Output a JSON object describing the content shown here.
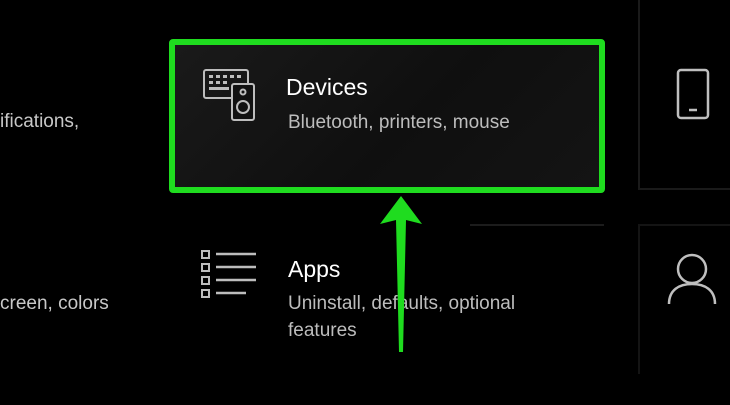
{
  "left_column": {
    "top_desc": "ifications,",
    "bottom_desc": "creen, colors"
  },
  "devices_tile": {
    "title": "Devices",
    "description": "Bluetooth, printers, mouse"
  },
  "apps_tile": {
    "title": "Apps",
    "description": "Uninstall, defaults, optional features"
  },
  "icons": {
    "devices": "keyboard-speaker-icon",
    "apps": "list-icon",
    "phone": "phone-icon",
    "accounts": "person-icon"
  },
  "colors": {
    "highlight": "#1fdc1f",
    "background": "#000000",
    "description_text": "#bdbdbd"
  }
}
